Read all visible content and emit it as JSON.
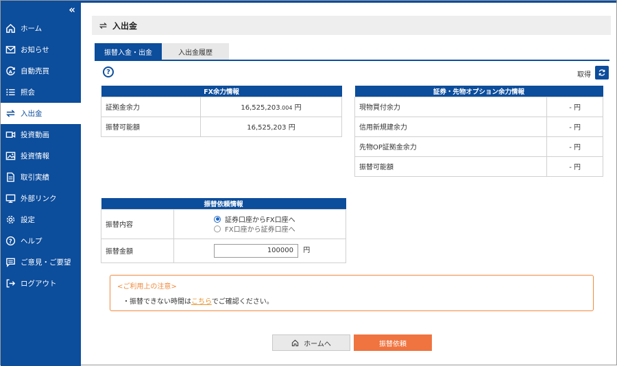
{
  "sidebar": {
    "collapse_icon": "chevron-double-left",
    "items": [
      {
        "label": "ホーム",
        "icon": "home-icon"
      },
      {
        "label": "お知らせ",
        "icon": "mail-icon"
      },
      {
        "label": "自動売買",
        "icon": "auto-trade-icon"
      },
      {
        "label": "照会",
        "icon": "list-icon"
      },
      {
        "label": "入出金",
        "icon": "transfer-icon",
        "active": true
      },
      {
        "label": "投資動画",
        "icon": "video-icon"
      },
      {
        "label": "投資情報",
        "icon": "image-icon"
      },
      {
        "label": "取引実績",
        "icon": "document-icon"
      },
      {
        "label": "外部リンク",
        "icon": "monitor-icon"
      },
      {
        "label": "設定",
        "icon": "gear-icon"
      },
      {
        "label": "ヘルプ",
        "icon": "help-icon"
      },
      {
        "label": "ご意見・ご要望",
        "icon": "comment-icon"
      },
      {
        "label": "ログアウト",
        "icon": "logout-icon"
      }
    ]
  },
  "page": {
    "title": "入出金",
    "tabs": [
      {
        "label": "振替入金・出金",
        "active": true
      },
      {
        "label": "入出金履歴",
        "active": false
      }
    ],
    "fetch_label": "取得"
  },
  "fx_table": {
    "header": "FX余力情報",
    "rows": [
      {
        "label": "証拠金余力",
        "value_main": "16,525,203",
        "value_decimal": ".004",
        "unit": "円"
      },
      {
        "label": "振替可能額",
        "value_main": "16,525,203",
        "value_decimal": "",
        "unit": "円"
      }
    ]
  },
  "securities_table": {
    "header": "証券・先物オプション余力情報",
    "rows": [
      {
        "label": "現物買付余力",
        "value": "- 円"
      },
      {
        "label": "信用新規建余力",
        "value": "- 円"
      },
      {
        "label": "先物OP証拠金余力",
        "value": "- 円"
      },
      {
        "label": "振替可能額",
        "value": "- 円"
      }
    ]
  },
  "request_table": {
    "header": "振替依頼情報",
    "type_label": "振替内容",
    "options": [
      {
        "label": "証券口座からFX口座へ",
        "checked": true
      },
      {
        "label": "FX口座から証券口座へ",
        "checked": false
      }
    ],
    "amount_label": "振替金額",
    "amount_value": "100000",
    "amount_unit": "円"
  },
  "notice": {
    "title": "<ご利用上の注意>",
    "text_before": "・振替できない時間は",
    "link": "こちら",
    "text_after": "でご確認ください。"
  },
  "buttons": {
    "home": "ホームへ",
    "submit": "振替依頼"
  },
  "colors": {
    "primary": "#0c4d9c",
    "accent": "#ef7440",
    "notice_border": "#f08a3c"
  }
}
